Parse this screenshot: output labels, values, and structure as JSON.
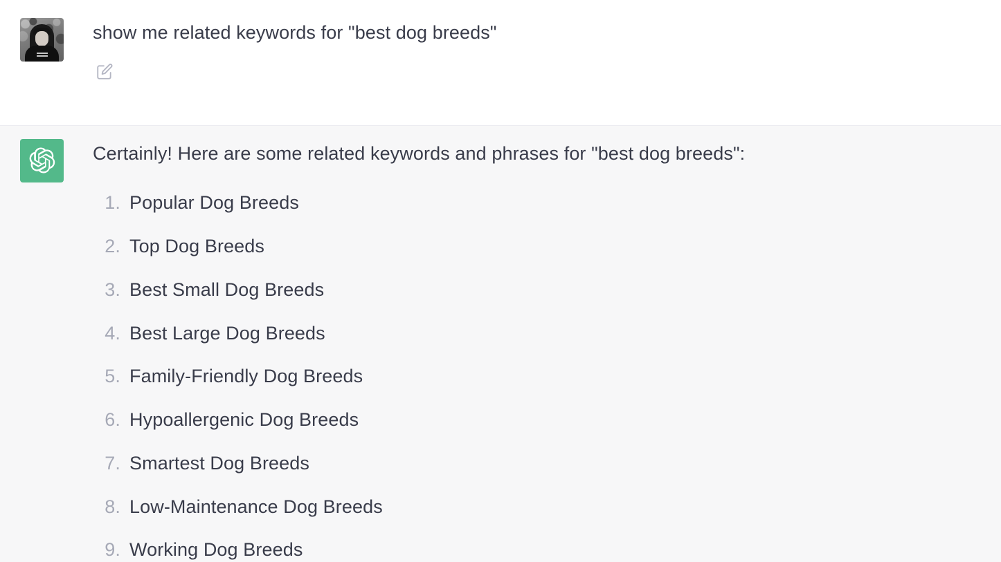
{
  "theme": {
    "user_row_bg": "#ffffff",
    "assistant_row_bg": "#f7f7f8",
    "divider": "#ececf1",
    "text": "#393c4a",
    "list_number": "#a6a9b6",
    "brand_green": "#53b98a",
    "icon_stroke": "#b4b6c3"
  },
  "conversation": {
    "user_message": {
      "author": "user",
      "avatar": "user-photo-avatar",
      "text": "show me related keywords for \"best dog breeds\"",
      "edit_icon": "edit-pencil-square-icon",
      "edit_label": "Edit message"
    },
    "assistant_message": {
      "author": "assistant",
      "avatar": "chatgpt-logo-icon",
      "intro": "Certainly! Here are some related keywords and phrases for \"best dog breeds\":",
      "list": [
        {
          "number": "1.",
          "label": "Popular Dog Breeds"
        },
        {
          "number": "2.",
          "label": "Top Dog Breeds"
        },
        {
          "number": "3.",
          "label": "Best Small Dog Breeds"
        },
        {
          "number": "4.",
          "label": "Best Large Dog Breeds"
        },
        {
          "number": "5.",
          "label": "Family-Friendly Dog Breeds"
        },
        {
          "number": "6.",
          "label": "Hypoallergenic Dog Breeds"
        },
        {
          "number": "7.",
          "label": "Smartest Dog Breeds"
        },
        {
          "number": "8.",
          "label": "Low-Maintenance Dog Breeds"
        },
        {
          "number": "9.",
          "label": "Working Dog Breeds"
        }
      ]
    }
  }
}
